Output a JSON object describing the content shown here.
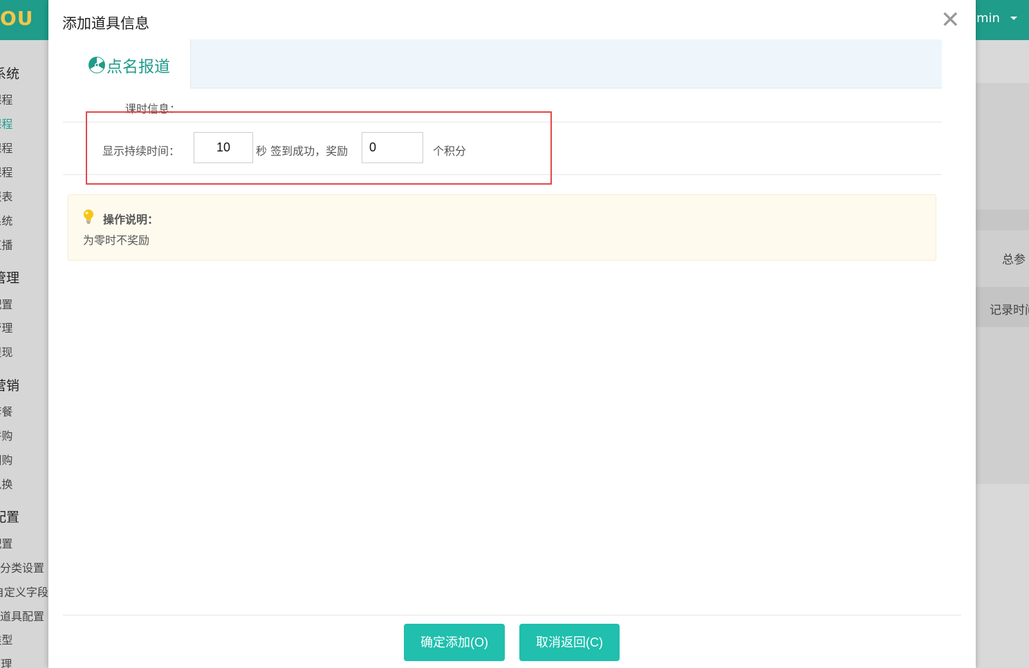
{
  "background": {
    "logo_text": "OU",
    "user_text": "min",
    "sidebar_items": [
      {
        "label": "系统",
        "head": true
      },
      {
        "label": "课程"
      },
      {
        "label": "课程",
        "active": true
      },
      {
        "label": "课程"
      },
      {
        "label": "课程"
      },
      {
        "label": "报表"
      },
      {
        "label": "系统"
      },
      {
        "label": "直播"
      },
      {
        "label": "管理",
        "head": true
      },
      {
        "label": "配置"
      },
      {
        "label": "管理"
      },
      {
        "label": "提现"
      },
      {
        "label": "营销",
        "head": true
      },
      {
        "label": "套餐"
      },
      {
        "label": "拼购"
      },
      {
        "label": "团购"
      },
      {
        "label": "兑换"
      },
      {
        "label": "配置",
        "head": true
      },
      {
        "label": "配置"
      },
      {
        "label": "分类设置"
      },
      {
        "label": "自定义字段"
      },
      {
        "label": "道具配置"
      },
      {
        "label": "类型"
      },
      {
        "label": "置管理"
      }
    ],
    "right_text_1": "总参",
    "right_text_2": "记录时间"
  },
  "modal": {
    "title": "添加道具信息",
    "close_glyph": "✕",
    "tab_label": "点名报道",
    "lesson_info_label": "课时信息：",
    "duration_label": "显示持续时间：",
    "duration_value": "10",
    "seconds_text": "秒 签到成功，奖励",
    "reward_value": "0",
    "points_text": "个积分",
    "note_title": "操作说明：",
    "note_text": "为零时不奖励",
    "confirm_button": "确定添加(O)",
    "cancel_button": "取消返回(C)"
  },
  "colors": {
    "brand": "#1f9c8a",
    "button": "#20bfae",
    "highlight_border": "#e04848",
    "note_bg": "#fefaee"
  }
}
